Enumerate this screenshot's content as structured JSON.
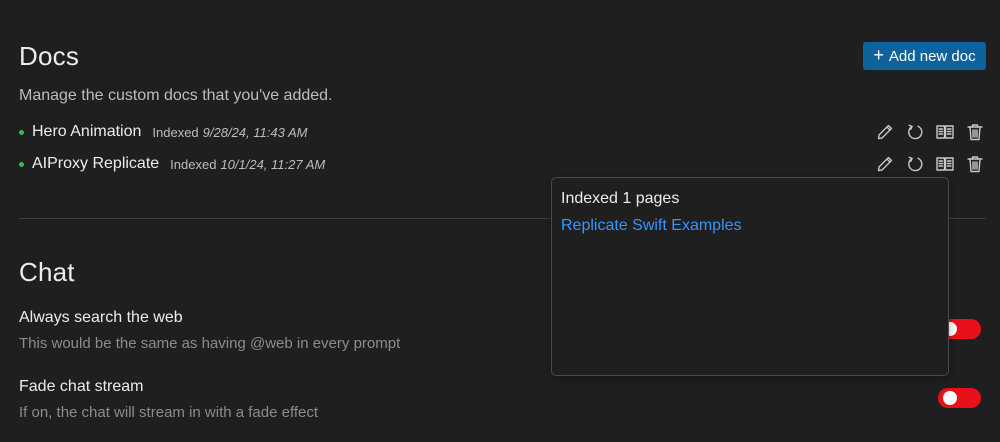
{
  "docs": {
    "title": "Docs",
    "add_button_label": "Add new doc",
    "description": "Manage the custom docs that you've added.",
    "items": [
      {
        "name": "Hero Animation",
        "status": "Indexed",
        "date": "9/28/24, 11:43 AM",
        "status_color": "#3fb950"
      },
      {
        "name": "AIProxy Replicate",
        "status": "Indexed",
        "date": "10/1/24, 11:27 AM",
        "status_color": "#3fb950"
      }
    ],
    "action_icons": [
      "edit-icon",
      "refresh-icon",
      "book-icon",
      "trash-icon"
    ]
  },
  "popup": {
    "title": "Indexed 1 pages",
    "pages": [
      "Replicate Swift Examples"
    ]
  },
  "chat": {
    "title": "Chat",
    "settings": [
      {
        "label": "Always search the web",
        "description": "This would be the same as having @web in every prompt",
        "enabled": false
      },
      {
        "label": "Fade chat stream",
        "description": "If on, the chat will stream in with a fade effect",
        "enabled": false
      }
    ]
  },
  "colors": {
    "background": "#1f1f1f",
    "accent_button": "#0e639c",
    "toggle": "#e8111a",
    "link": "#3794ff",
    "status_dot": "#3fb950"
  }
}
